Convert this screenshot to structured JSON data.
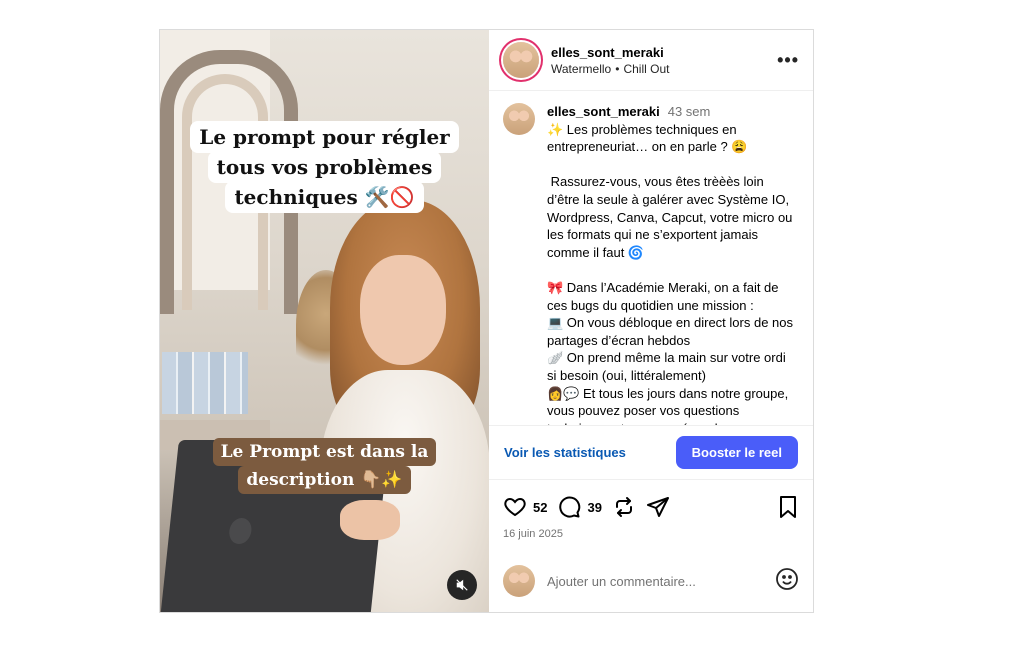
{
  "media": {
    "title_lines": [
      "Le prompt pour régler",
      "tous vos problèmes",
      "techniques 🛠️🚫"
    ],
    "caption_lines": [
      "Le Prompt est dans la",
      "description 👇🏼✨"
    ],
    "mute_icon": "speaker-muted-icon"
  },
  "header": {
    "username": "elles_sont_meraki",
    "audio_artist": "Watermello",
    "audio_track": "Chill Out",
    "separator": "•",
    "more_label": "•••"
  },
  "caption": {
    "username": "elles_sont_meraki",
    "time": "43 sem",
    "text": "✨ Les problèmes techniques en entrepreneuriat… on en parle ? 😩\n\n Rassurez-vous, vous êtes trèèès loin d’être la seule à galérer avec Système IO, Wordpress, Canva, Capcut, votre micro ou les formats qui ne s’exportent jamais comme il faut 🌀\n\n🎀 Dans l’Académie Meraki, on a fait de ces bugs du quotidien une mission :\n💻 On vous débloque en direct lors de nos partages d’écran hebdos\n🪽 On prend même la main sur votre ordi si besoin (oui, littéralement)\n👩💬 Et tous les jours dans notre groupe, vous pouvez poser vos questions techniques et on vous répond"
  },
  "stats_bar": {
    "stats_link": "Voir les statistiques",
    "boost_label": "Booster le reel"
  },
  "actions": {
    "likes": "52",
    "comments": "39",
    "date": "16 juin 2025"
  },
  "add_comment": {
    "placeholder": "Ajouter un commentaire..."
  },
  "colors": {
    "accent": "#4a5df9",
    "link": "#0a59b3",
    "caption_bg": "#7c5b3f"
  }
}
